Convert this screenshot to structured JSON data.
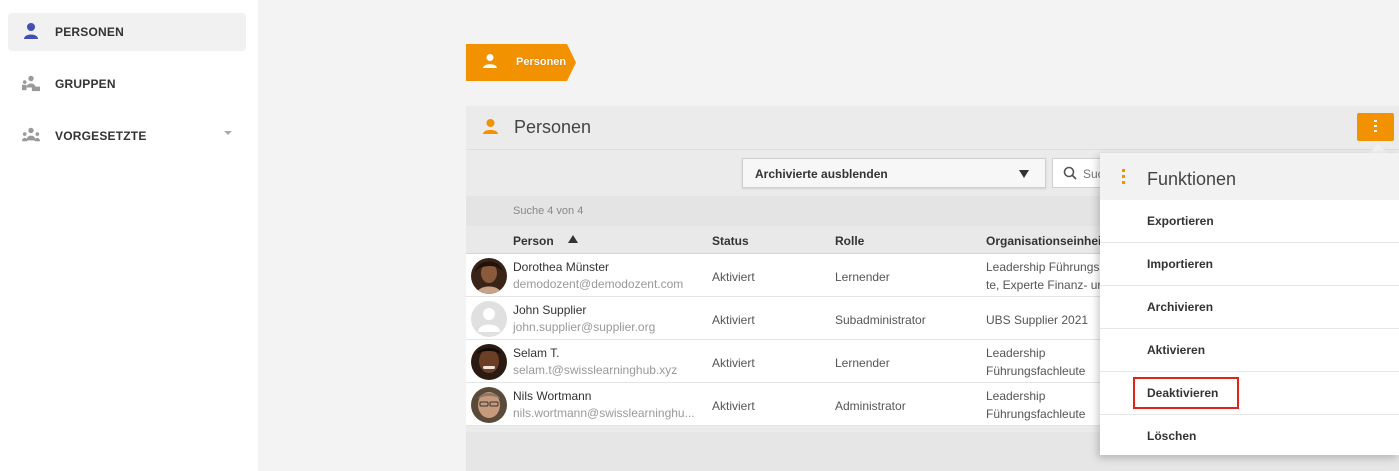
{
  "colors": {
    "accent": "#f39200",
    "highlight": "#e2231a",
    "sidebar_active_icon": "#3f51b5"
  },
  "sidebar": {
    "items": [
      {
        "label": "PERSONEN",
        "icon": "person-icon",
        "active": true
      },
      {
        "label": "GRUPPEN",
        "icon": "group-icon",
        "active": false
      },
      {
        "label": "VORGESETZTE",
        "icon": "supervisors-icon",
        "active": false,
        "expandable": true
      }
    ]
  },
  "breadcrumb": {
    "label": "Personen",
    "icon": "person-icon"
  },
  "panel": {
    "title": "Personen",
    "icon": "person-icon",
    "menu_icon": "more-vertical-icon",
    "filter": {
      "selected": "Archivierte ausblenden"
    },
    "search": {
      "placeholder": "Suchen",
      "icon": "search-icon"
    },
    "result_count": "Suche 4 von 4"
  },
  "table": {
    "columns": [
      "Person",
      "Status",
      "Rolle",
      "Organisationseinheit"
    ],
    "sort_column": "Person",
    "sort_direction": "ascending",
    "rows": [
      {
        "name": "Dorothea Münster",
        "email": "demodozent@demodozent.com",
        "status": "Aktiviert",
        "role": "Lernender",
        "org_line1": "Leadership Führungs",
        "org_line2": "te, Experte Finanz- ur",
        "avatar": "photo-avatar"
      },
      {
        "name": "John Supplier",
        "email": "john.supplier@supplier.org",
        "status": "Aktiviert",
        "role": "Subadministrator",
        "org_line1": "UBS Supplier 2021",
        "org_line2": "",
        "avatar": "default-avatar"
      },
      {
        "name": "Selam T.",
        "email": "selam.t@swisslearninghub.xyz",
        "status": "Aktiviert",
        "role": "Lernender",
        "org_line1": "Leadership",
        "org_line2": "Führungsfachleute",
        "avatar": "photo-avatar"
      },
      {
        "name": "Nils Wortmann",
        "email": "nils.wortmann@swisslearninghu...",
        "status": "Aktiviert",
        "role": "Administrator",
        "org_line1": "Leadership",
        "org_line2": "Führungsfachleute",
        "avatar": "photo-avatar"
      }
    ]
  },
  "functions_menu": {
    "title": "Funktionen",
    "items": [
      {
        "label": "Exportieren"
      },
      {
        "label": "Importieren"
      },
      {
        "label": "Archivieren"
      },
      {
        "label": "Aktivieren"
      },
      {
        "label": "Deaktivieren",
        "highlighted": true
      },
      {
        "label": "Löschen"
      }
    ]
  }
}
